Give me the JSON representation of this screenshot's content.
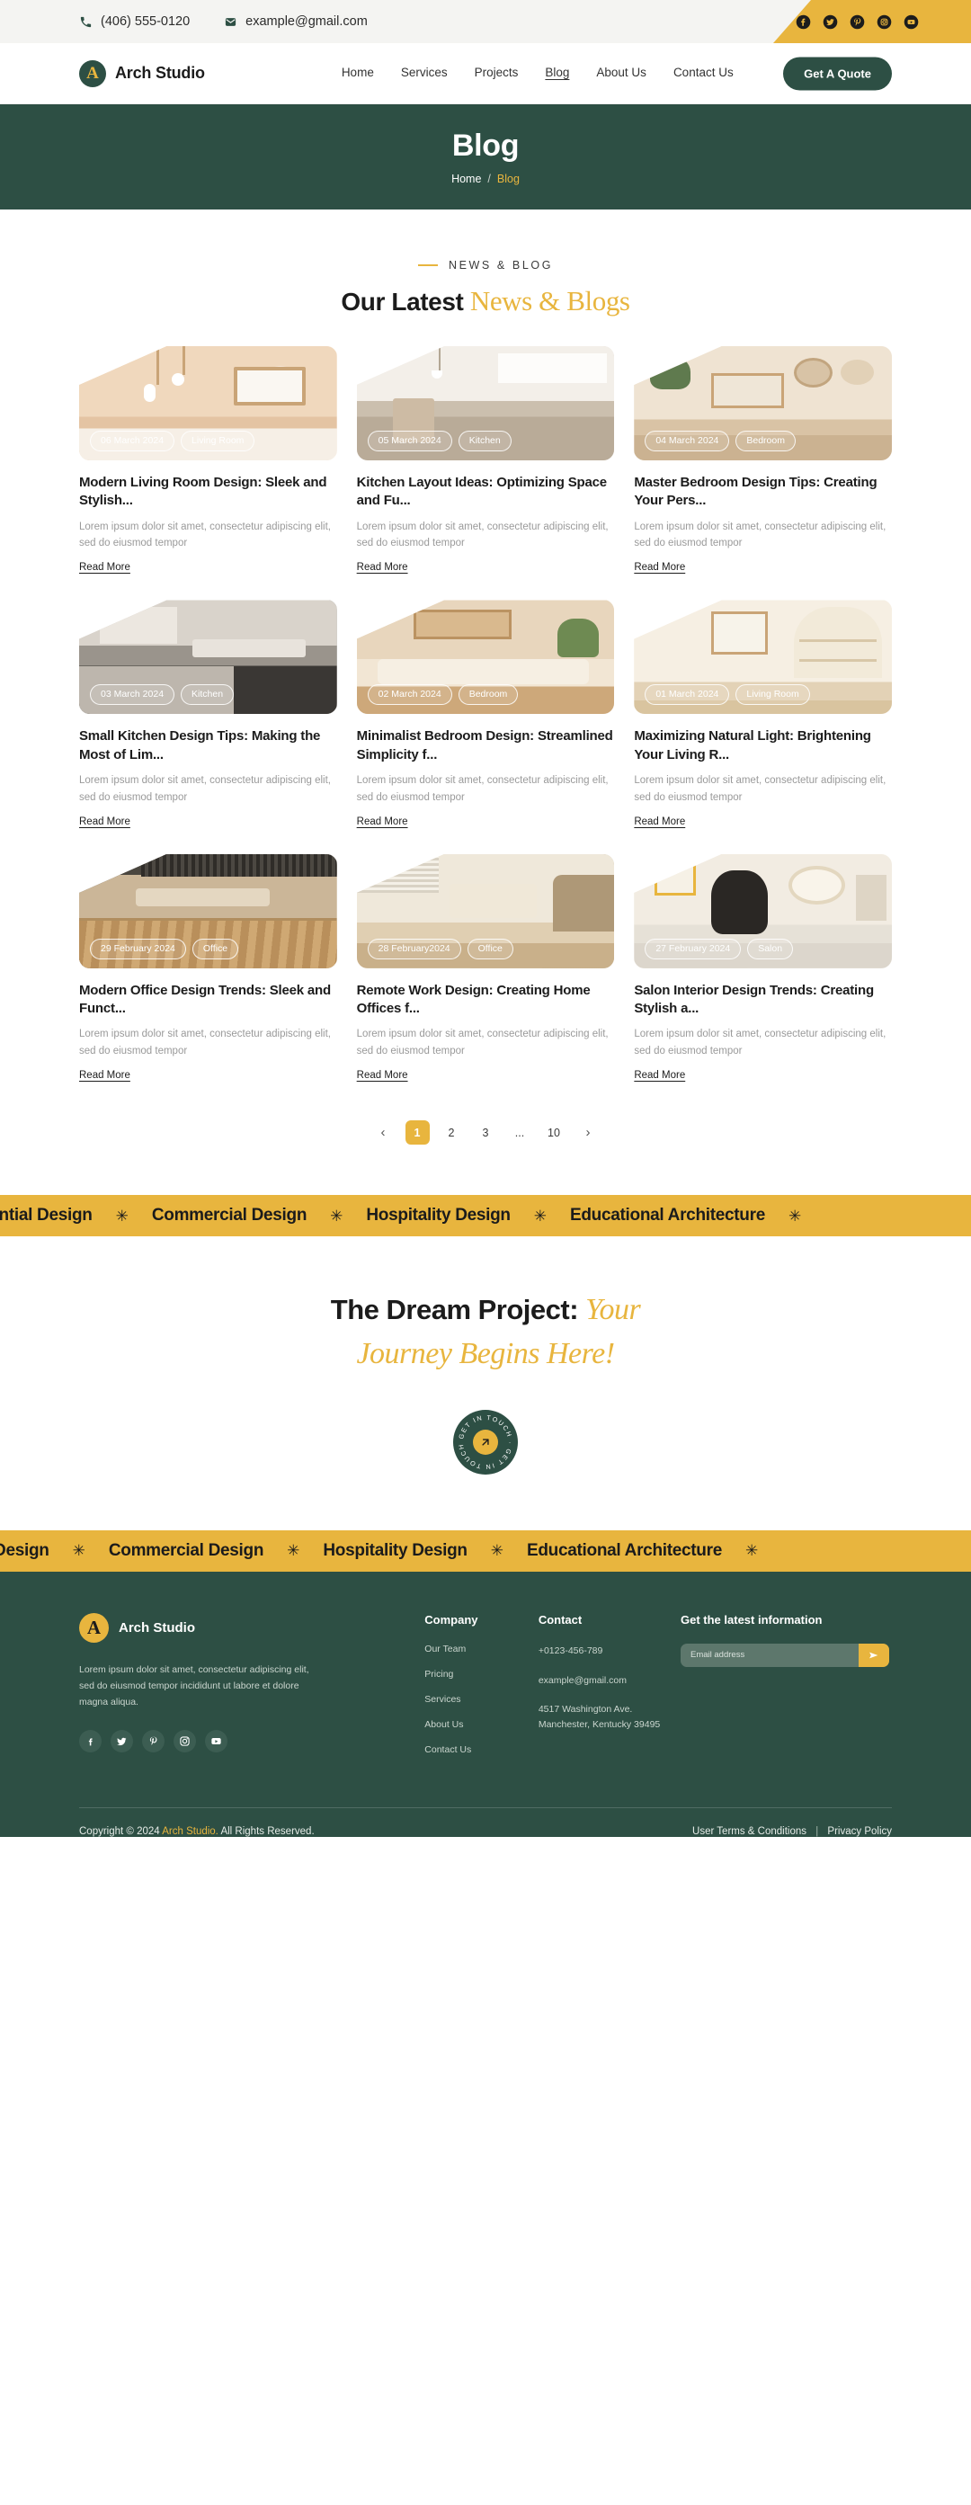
{
  "topbar": {
    "phone": "(406) 555-0120",
    "email": "example@gmail.com",
    "phone_icon": "phone-icon",
    "email_icon": "mail-icon",
    "socials": [
      "facebook-icon",
      "twitter-icon",
      "pinterest-icon",
      "instagram-icon",
      "youtube-icon"
    ]
  },
  "nav": {
    "brand_initial": "A",
    "brand_name": "Arch Studio",
    "links": [
      {
        "label": "Home",
        "active": false
      },
      {
        "label": "Services",
        "active": false
      },
      {
        "label": "Projects",
        "active": false
      },
      {
        "label": "Blog",
        "active": true
      },
      {
        "label": "About Us",
        "active": false
      },
      {
        "label": "Contact Us",
        "active": false
      }
    ],
    "cta_label": "Get A Quote"
  },
  "hero": {
    "title": "Blog",
    "crumb_home": "Home",
    "crumb_sep": "/",
    "crumb_current": "Blog"
  },
  "section": {
    "eyebrow": "NEWS & BLOG",
    "title_dark": "Our Latest",
    "title_accent": "News & Blogs"
  },
  "posts": [
    {
      "date": "06 March 2024",
      "category": "Living Room",
      "title": "Modern Living Room Design: Sleek and Stylish...",
      "excerpt": "Lorem ipsum dolor sit amet, consectetur adipiscing elit, sed do eiusmod tempor",
      "link_label": "Read More",
      "img": "living-room-pendant-lamps"
    },
    {
      "date": "05 March 2024",
      "category": "Kitchen",
      "title": "Kitchen Layout Ideas: Optimizing Space and Fu...",
      "excerpt": "Lorem ipsum dolor sit amet, consectetur adipiscing elit, sed do eiusmod tempor",
      "link_label": "Read More",
      "img": "white-kitchen-island"
    },
    {
      "date": "04 March 2024",
      "category": "Bedroom",
      "title": "Master Bedroom Design Tips: Creating Your Pers...",
      "excerpt": "Lorem ipsum dolor sit amet, consectetur adipiscing elit, sed do eiusmod tempor",
      "link_label": "Read More",
      "img": "beige-master-bedroom"
    },
    {
      "date": "03 March 2024",
      "category": "Kitchen",
      "title": "Small Kitchen Design Tips: Making the Most of Lim...",
      "excerpt": "Lorem ipsum dolor sit amet, consectetur adipiscing elit, sed do eiusmod tempor",
      "link_label": "Read More",
      "img": "dark-small-kitchen"
    },
    {
      "date": "02 March 2024",
      "category": "Bedroom",
      "title": "Minimalist Bedroom Design: Streamlined Simplicity f...",
      "excerpt": "Lorem ipsum dolor sit amet, consectetur adipiscing elit, sed do eiusmod tempor",
      "link_label": "Read More",
      "img": "minimalist-bedroom"
    },
    {
      "date": "01 March 2024",
      "category": "Living Room",
      "title": "Maximizing Natural Light: Brightening Your Living R...",
      "excerpt": "Lorem ipsum dolor sit amet, consectetur adipiscing elit, sed do eiusmod tempor",
      "link_label": "Read More",
      "img": "bright-living-room-shelf"
    },
    {
      "date": "29 February 2024",
      "category": "Office",
      "title": "Modern Office Design Trends: Sleek and Funct...",
      "excerpt": "Lorem ipsum dolor sit amet, consectetur adipiscing elit, sed do eiusmod tempor",
      "link_label": "Read More",
      "img": "modern-office-meeting-room"
    },
    {
      "date": "28 February2024",
      "category": "Office",
      "title": "Remote Work Design: Creating Home Offices f...",
      "excerpt": "Lorem ipsum dolor sit amet, consectetur adipiscing elit, sed do eiusmod tempor",
      "link_label": "Read More",
      "img": "home-office-desk"
    },
    {
      "date": "27 February 2024",
      "category": "Salon",
      "title": "Salon Interior Design Trends: Creating Stylish a...",
      "excerpt": "Lorem ipsum dolor sit amet, consectetur adipiscing elit, sed do eiusmod tempor",
      "link_label": "Read More",
      "img": "salon-interior-mirrors"
    }
  ],
  "pagination": {
    "prev_icon": "chevron-left-icon",
    "next_icon": "chevron-right-icon",
    "pages": [
      "1",
      "2",
      "3",
      "...",
      "10"
    ],
    "current": "1"
  },
  "marquee": {
    "items": [
      "Residential Design",
      "Commercial Design",
      "Hospitality Design",
      "Educational Architecture"
    ],
    "separator": "✳"
  },
  "cta": {
    "title_dark": "The Dream Project:",
    "title_accent_1": "Your",
    "title_accent_2": "Journey Begins Here!",
    "badge_text": "GET IN TOUCH · GET IN TOUCH ·",
    "badge_icon": "arrow-up-right-icon"
  },
  "footer": {
    "brand_initial": "A",
    "brand_name": "Arch Studio",
    "description": "Lorem ipsum dolor sit amet, consectetur adipiscing elit, sed do eiusmod tempor incididunt ut labore et dolore magna aliqua.",
    "socials": [
      "facebook-icon",
      "twitter-icon",
      "pinterest-icon",
      "instagram-icon",
      "youtube-icon"
    ],
    "company": {
      "heading": "Company",
      "links": [
        "Our Team",
        "Pricing",
        "Services",
        "About Us",
        "Contact Us"
      ]
    },
    "contact": {
      "heading": "Contact",
      "phone": "+0123-456-789",
      "email": "example@gmail.com",
      "address": "4517 Washington Ave. Manchester, Kentucky 39495"
    },
    "newsletter": {
      "heading": "Get the latest information",
      "placeholder": "Email address",
      "value": "",
      "submit_icon": "send-icon"
    },
    "bottom": {
      "copyright_pre": "Copyright © 2024",
      "copyright_brand": "Arch Studio.",
      "copyright_post": "All Rights Reserved.",
      "terms": "User Terms & Conditions",
      "divider": "|",
      "privacy": "Privacy Policy"
    }
  },
  "colors": {
    "green": "#2d4f44",
    "gold": "#e8b53e",
    "dark": "#1c1c1c"
  }
}
